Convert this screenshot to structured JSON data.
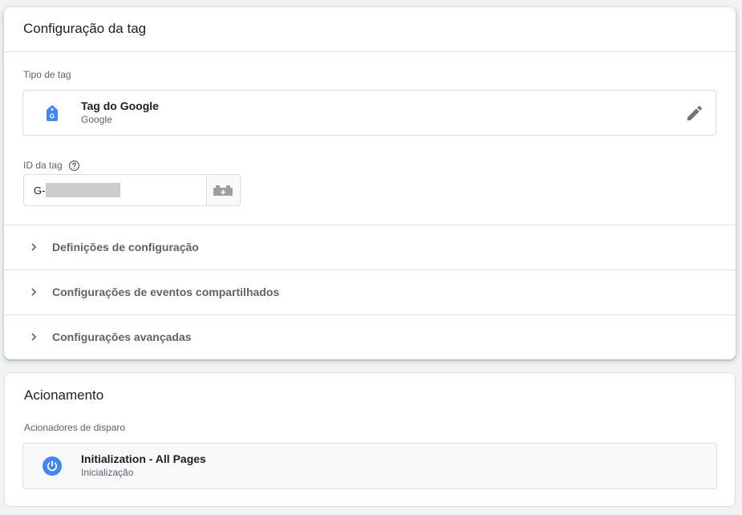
{
  "tag_config": {
    "title": "Configuração da tag",
    "tag_type_label": "Tipo de tag",
    "tag_type": {
      "name": "Tag do Google",
      "provider": "Google",
      "icon": "google-tag-icon"
    },
    "tag_id": {
      "label": "ID da tag",
      "value": "G-"
    },
    "sections": [
      {
        "label": "Definições de configuração"
      },
      {
        "label": "Configurações de eventos compartilhados"
      },
      {
        "label": "Configurações avançadas"
      }
    ]
  },
  "triggering": {
    "title": "Acionamento",
    "triggers_label": "Acionadores de disparo",
    "trigger": {
      "name": "Initialization - All Pages",
      "type": "Inicialização",
      "icon": "power-icon"
    }
  },
  "colors": {
    "google_blue": "#4285f4",
    "trigger_blue": "#4285f4",
    "icon_grey": "#757575"
  }
}
